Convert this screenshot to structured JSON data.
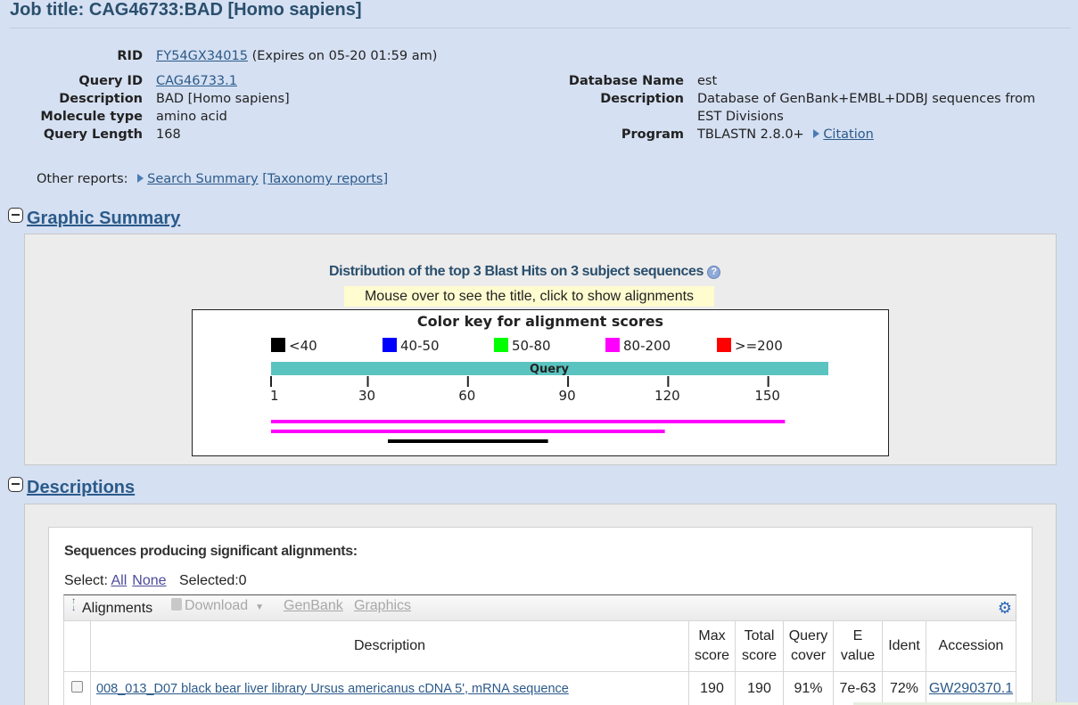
{
  "job": {
    "title_prefix": "Job title: ",
    "title": "CAG46733:BAD [Homo sapiens]"
  },
  "info": {
    "rid_label": "RID",
    "rid": "FY54GX34015",
    "rid_expiry": "(Expires on 05-20 01:59 am)",
    "query_id_label": "Query ID",
    "query_id": "CAG46733.1",
    "description_label": "Description",
    "description": "BAD [Homo sapiens]",
    "molecule_label": "Molecule type",
    "molecule": "amino acid",
    "length_label": "Query Length",
    "length": "168",
    "db_name_label": "Database Name",
    "db_name": "est",
    "db_desc_label": "Description",
    "db_desc_line1": "Database of GenBank+EMBL+DDBJ sequences from",
    "db_desc_line2": "EST Divisions",
    "program_label": "Program",
    "program": "TBLASTN 2.8.0+",
    "citation": "Citation"
  },
  "other_reports": {
    "label": "Other reports:",
    "search_summary": "Search Summary",
    "taxonomy": "[Taxonomy reports]"
  },
  "graphic_summary": {
    "heading": "Graphic Summary",
    "dist_title": "Distribution of the top 3 Blast Hits on 3 subject sequences",
    "help_icon": "?",
    "mouse_note": "Mouse over to see the title, click to show alignments",
    "color_key_title": "Color key for alignment scores",
    "keys": [
      {
        "label": "<40",
        "color": "#000000"
      },
      {
        "label": "40-50",
        "color": "#0000ff"
      },
      {
        "label": "50-80",
        "color": "#00ff00"
      },
      {
        "label": "80-200",
        "color": "#ff00ff"
      },
      {
        "label": ">=200",
        "color": "#ff0000"
      }
    ],
    "query_label": "Query",
    "query_length": 168,
    "ticks": [
      "1",
      "30",
      "60",
      "90",
      "120",
      "150"
    ],
    "hits": [
      {
        "start": 1,
        "end": 155,
        "color": "#ff00ff"
      },
      {
        "start": 1,
        "end": 119,
        "color": "#ff00ff"
      },
      {
        "start": 36,
        "end": 84,
        "color": "#000000"
      }
    ]
  },
  "descriptions": {
    "heading": "Descriptions",
    "seq_title": "Sequences producing significant alignments:",
    "select_label": "Select:",
    "select_all": "All",
    "select_none": "None",
    "selected": "Selected:0",
    "toolbar": {
      "alignments": "Alignments",
      "download": "Download",
      "genbank": "GenBank",
      "graphics": "Graphics",
      "gear_icon": "gear-icon"
    },
    "columns": {
      "description": "Description",
      "max1": "Max",
      "max2": "score",
      "total1": "Total",
      "total2": "score",
      "qc1": "Query",
      "qc2": "cover",
      "e1": "E",
      "e2": "value",
      "ident": "Ident",
      "accession": "Accession"
    },
    "rows": [
      {
        "description": "008_013_D07 black bear liver library Ursus americanus cDNA 5', mRNA sequence",
        "max": "190",
        "total": "190",
        "cover": "91%",
        "evalue": "7e-63",
        "ident": "72%",
        "accession": "GW290370.1"
      }
    ]
  }
}
